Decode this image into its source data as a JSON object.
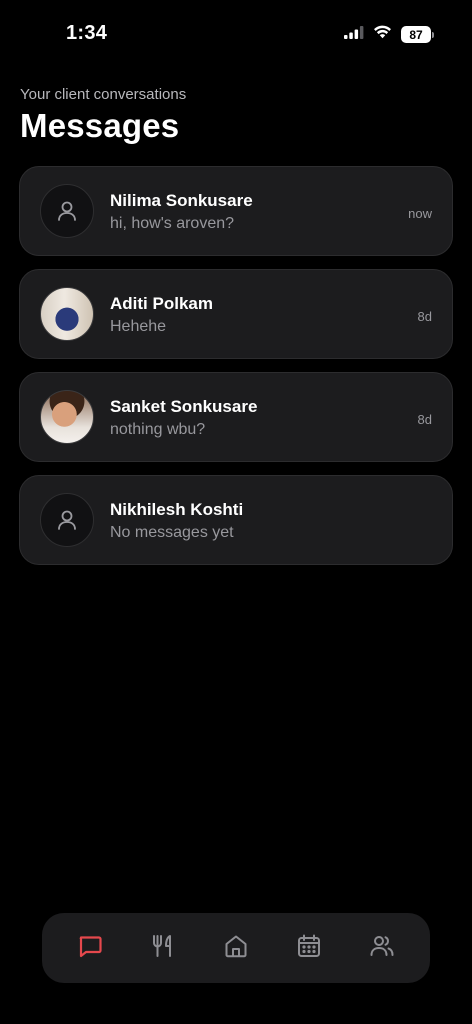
{
  "status_bar": {
    "time": "1:34",
    "battery": "87"
  },
  "header": {
    "subtitle": "Your client conversations",
    "title": "Messages"
  },
  "conversations": [
    {
      "name": "Nilima Sonkusare",
      "preview": "hi, how's aroven?",
      "time": "now",
      "avatar": "user-icon"
    },
    {
      "name": "Aditi Polkam",
      "preview": "Hehehe",
      "time": "8d",
      "avatar": "photo"
    },
    {
      "name": "Sanket Sonkusare",
      "preview": "nothing wbu?",
      "time": "8d",
      "avatar": "photo"
    },
    {
      "name": "Nikhilesh Koshti",
      "preview": "No messages yet",
      "time": "",
      "avatar": "user-icon"
    }
  ],
  "tab_bar": {
    "tabs": [
      {
        "icon": "message-icon",
        "active": true
      },
      {
        "icon": "utensils-icon",
        "active": false
      },
      {
        "icon": "home-icon",
        "active": false
      },
      {
        "icon": "calendar-icon",
        "active": false
      },
      {
        "icon": "users-icon",
        "active": false
      }
    ],
    "active_color": "#e5484d",
    "inactive_color": "#8e8e93"
  }
}
